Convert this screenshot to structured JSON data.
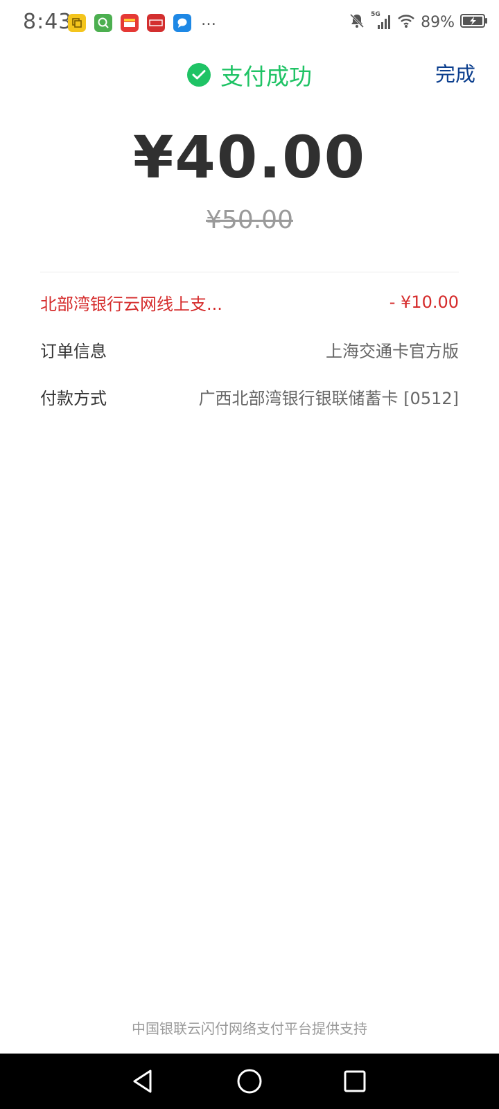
{
  "status_bar": {
    "time": "8:43",
    "battery_percent": "89%",
    "network": "5G",
    "apps": [
      {
        "icon": "copy-app-icon",
        "color": "#f4c51d"
      },
      {
        "icon": "search-app-icon",
        "color": "#4caf50"
      },
      {
        "icon": "wallet-app-icon",
        "color": "#e53935"
      },
      {
        "icon": "cloudpay-app-icon",
        "color": "#d32f2f"
      },
      {
        "icon": "message-app-icon",
        "color": "#1e88e5"
      }
    ]
  },
  "header": {
    "title": "支付成功",
    "done_label": "完成"
  },
  "amount": {
    "paid": "¥40.00",
    "original": "¥50.00"
  },
  "details": {
    "discount": {
      "label": "北部湾银行云网线上支...",
      "value": "- ¥10.00"
    },
    "order": {
      "label": "订单信息",
      "value": "上海交通卡官方版"
    },
    "payment": {
      "label": "付款方式",
      "value": "广西北部湾银行银联储蓄卡 [0512]"
    }
  },
  "footer": {
    "text": "中国银联云闪付网络支付平台提供支持"
  },
  "colors": {
    "success": "#1fc365",
    "link": "#0c3f8e",
    "discount": "#d52b2b"
  }
}
